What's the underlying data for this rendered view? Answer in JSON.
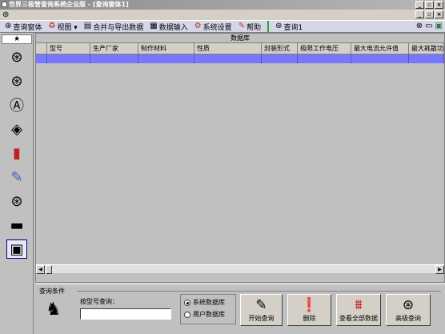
{
  "window": {
    "title": "世界三极管查询系统企业版 - [查询窗体1]"
  },
  "toolbar": {
    "items": [
      {
        "icon": "binoculars-icon",
        "label": "查询窗体"
      },
      {
        "icon": "recycle-icon",
        "label": "视图 ▾"
      },
      {
        "icon": "folders-icon",
        "label": "合并与导出数据"
      },
      {
        "icon": "document-icon",
        "label": "数据输入"
      },
      {
        "icon": "settings-icon",
        "label": "系统设置"
      },
      {
        "icon": "help-icon",
        "label": "帮助"
      }
    ],
    "tab_label": "查询1"
  },
  "sidebar": {
    "star": "★"
  },
  "grid": {
    "title": "数据库",
    "columns": [
      "型号",
      "生产厂家",
      "制作材料",
      "性质",
      "封装形式",
      "极限工作电压",
      "最大电流允许值",
      "最大耗散功"
    ]
  },
  "query": {
    "title": "查询条件",
    "search_label": "按型号查询：",
    "search_value": "",
    "radio_system": "系统数据库",
    "radio_user": "用户数据库",
    "btn_start": "开始查询",
    "btn_delete": "删除",
    "btn_view_all": "查看全部数据",
    "btn_advanced": "高级查询"
  }
}
